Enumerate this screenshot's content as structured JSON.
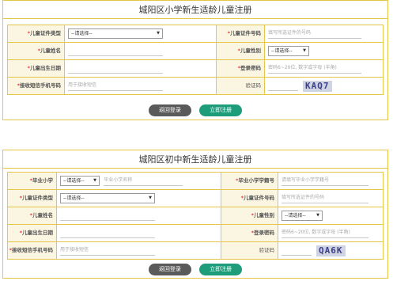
{
  "form1": {
    "title": "城阳区小学新生适龄儿童注册",
    "id_type": {
      "label": "儿童证件类型",
      "value": "--请选择--"
    },
    "id_number": {
      "label": "儿童证件号码",
      "placeholder": "填写所选证件的号码"
    },
    "name": {
      "label": "儿童姓名"
    },
    "gender": {
      "label": "儿童性别",
      "value": "--请选择--"
    },
    "birthdate": {
      "label": "儿童出生日期"
    },
    "password": {
      "label": "登录密码",
      "placeholder": "密码6~20位, 数字或字母 (半角)"
    },
    "phone": {
      "label": "接收短信手机号码",
      "placeholder": "用于接收短信"
    },
    "captcha": {
      "label": "验证码",
      "image_text": "KAQ7"
    },
    "back_button": "返回登录",
    "submit_button": "立即注册"
  },
  "form2": {
    "title": "城阳区初中新生适龄儿童注册",
    "grad_school": {
      "label": "毕业小学",
      "value": "--请选择--",
      "placeholder": "毕业小学名称"
    },
    "student_number": {
      "label": "毕业小学学籍号",
      "placeholder": "请填写毕业小学学籍号"
    },
    "id_type": {
      "label": "儿童证件类型",
      "value": "--请选择--"
    },
    "id_number": {
      "label": "儿童证件号码",
      "placeholder": "填写所选证件的号码"
    },
    "name": {
      "label": "儿童姓名"
    },
    "gender": {
      "label": "儿童性别",
      "value": "--请选择--"
    },
    "birthdate": {
      "label": "儿童出生日期"
    },
    "password": {
      "label": "登录密码",
      "placeholder": "密码6~20位, 数字或字母 (半角)"
    },
    "phone": {
      "label": "接收短信手机号码",
      "placeholder": "用于接收短信"
    },
    "captcha": {
      "label": "验证码",
      "image_text": "QA6K"
    },
    "back_button": "返回登录",
    "submit_button": "立即注册"
  },
  "colors": {
    "border": "#e6c64a",
    "label_bg": "#fbf6e2",
    "required": "#e23b3b",
    "submit": "#1e9d7a",
    "back": "#5a5a5a"
  }
}
